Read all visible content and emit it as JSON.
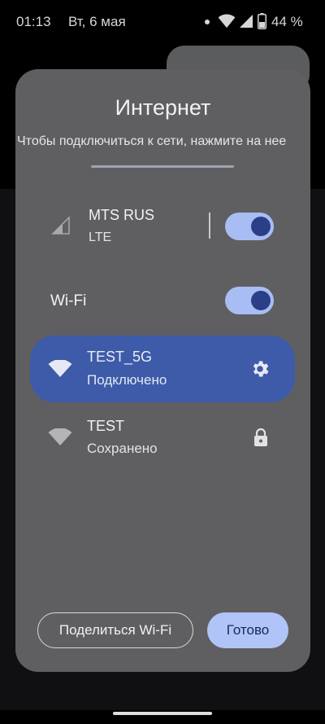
{
  "statusbar": {
    "time": "01:13",
    "date": "Вт, 6 мая",
    "battery_percent": "44 %",
    "battery_level": 0.44
  },
  "dialog": {
    "title": "Интернет",
    "subtitle": "Чтобы подключиться к сети, нажмите на нее",
    "mobile": {
      "name": "MTS RUS",
      "type": "LTE",
      "enabled": true
    },
    "wifi": {
      "label": "Wi-Fi",
      "enabled": true
    },
    "networks": [
      {
        "ssid": "TEST_5G",
        "status": "Подключено",
        "action_icon": "gear-icon"
      },
      {
        "ssid": "TEST",
        "status": "Сохранено",
        "action_icon": "lock-icon"
      }
    ],
    "buttons": {
      "share": "Поделиться Wi-Fi",
      "done": "Готово"
    }
  },
  "colors": {
    "dialog_bg": "#5f5f61",
    "accent": "#a8bdf3",
    "active_row": "#3d5ba8",
    "toggle_knob": "#2a3f86"
  }
}
